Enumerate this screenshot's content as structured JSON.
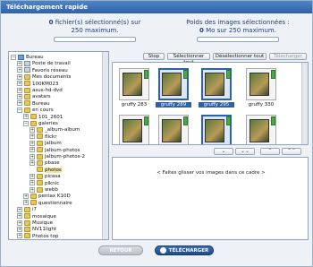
{
  "window": {
    "title": "Téléchargement rapide"
  },
  "status": {
    "files_count": "0",
    "files_text": "fichier(s) sélectionné(s) sur",
    "files_max": "250 maximum.",
    "weight_title": "Poids des images sélectionnées :",
    "weight_value": "0",
    "weight_text": "Mo sur 250 maximum."
  },
  "tree": {
    "items": [
      {
        "label": "Bureau",
        "expander": "−",
        "icon": "desktop-icon"
      },
      {
        "label": "Poste de travail",
        "expander": "+",
        "icon": "computer-icon"
      },
      {
        "label": "Favoris réseau",
        "expander": "+",
        "icon": "network-icon"
      },
      {
        "label": "Mes documents",
        "expander": "+",
        "icon": "folder-icon"
      },
      {
        "label": "100KM023",
        "expander": "+",
        "icon": "folder-icon"
      },
      {
        "label": "asus-hd-dvd",
        "expander": "+",
        "icon": "folder-icon"
      },
      {
        "label": "avatars",
        "expander": "+",
        "icon": "folder-icon"
      },
      {
        "label": "Bureau",
        "expander": "+",
        "icon": "folder-icon"
      },
      {
        "label": "en cours",
        "expander": "−",
        "icon": "folder-icon"
      },
      {
        "label": "101_2601",
        "expander": "+",
        "icon": "folder-icon"
      },
      {
        "label": "galeries",
        "expander": "−",
        "icon": "folder-icon"
      },
      {
        "label": "_album-album",
        "expander": "+",
        "icon": "folder-icon"
      },
      {
        "label": "flickr",
        "expander": "+",
        "icon": "folder-icon"
      },
      {
        "label": "jalbum",
        "expander": "+",
        "icon": "folder-icon"
      },
      {
        "label": "jalbum-photos",
        "expander": "+",
        "icon": "folder-icon"
      },
      {
        "label": "jalbum-photos-2",
        "expander": "+",
        "icon": "folder-icon"
      },
      {
        "label": "pbase",
        "expander": "+",
        "icon": "folder-icon"
      },
      {
        "label": "photos",
        "expander": "",
        "icon": "folder-icon",
        "selected": true
      },
      {
        "label": "picasa",
        "expander": "+",
        "icon": "folder-icon"
      },
      {
        "label": "piknic",
        "expander": "+",
        "icon": "folder-icon"
      },
      {
        "label": "webb",
        "expander": "+",
        "icon": "folder-icon"
      },
      {
        "label": "pentax K10D",
        "expander": "+",
        "icon": "folder-icon"
      },
      {
        "label": "questionnaire",
        "expander": "+",
        "icon": "folder-icon"
      },
      {
        "label": "i7",
        "expander": "+",
        "icon": "folder-icon"
      },
      {
        "label": "mosaique",
        "expander": "+",
        "icon": "folder-icon"
      },
      {
        "label": "Musique",
        "expander": "+",
        "icon": "folder-icon"
      },
      {
        "label": "NV11light",
        "expander": "+",
        "icon": "folder-icon"
      },
      {
        "label": "Photos top",
        "expander": "+",
        "icon": "folder-icon"
      }
    ]
  },
  "toolbar": {
    "stop": "Stop",
    "select_all": "Sélectionner tout",
    "deselect_all": "Désélectionner tout",
    "upload": "Télécharger"
  },
  "thumbnails": [
    {
      "label": "gruffy 283",
      "selected": false
    },
    {
      "label": "gruffy 289",
      "selected": true
    },
    {
      "label": "gruffy 295",
      "selected": true
    },
    {
      "label": "gruffy 330",
      "selected": false
    }
  ],
  "nav": {
    "down": "⌄",
    "down_all": "⌄⌄",
    "up": "⌃",
    "up_all": "⌃⌃"
  },
  "dropzone": {
    "text": "< Faites glisser vos images dans ce cadre >"
  },
  "actions": {
    "back": "RETOUR",
    "upload": "TÉLÉCHARGER"
  },
  "colors": {
    "accent": "#2d62a8",
    "title_bar": "#3a70b4",
    "upload_button": "#1f4a8c"
  }
}
